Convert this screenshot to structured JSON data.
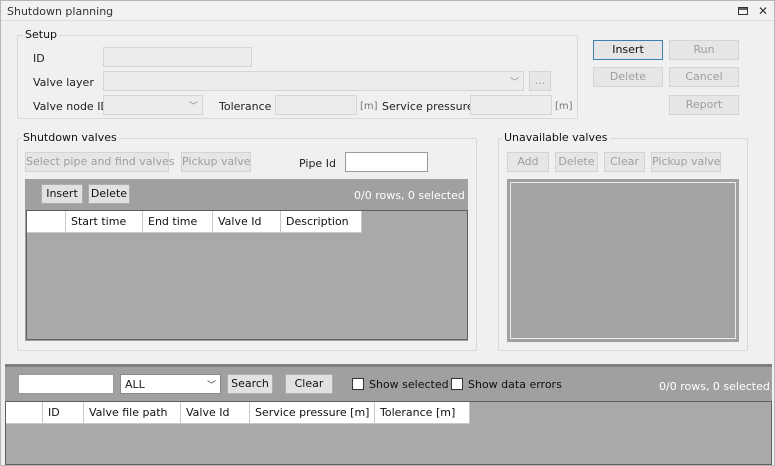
{
  "window": {
    "title": "Shutdown planning",
    "minimize_icon": "minimize-icon",
    "close_icon": "close-icon"
  },
  "setup": {
    "legend": "Setup",
    "id_label": "ID",
    "id_value": "",
    "valve_layer_label": "Valve layer",
    "valve_layer_value": "",
    "browse_label": "...",
    "valve_node_id_label": "Valve node ID",
    "valve_node_id_value": "",
    "tolerance_label": "Tolerance",
    "tolerance_value": "",
    "tolerance_unit": "[m]",
    "service_pressure_label": "Service pressure",
    "service_pressure_value": "",
    "service_pressure_unit": "[m]"
  },
  "actions": {
    "insert": "Insert",
    "run": "Run",
    "delete": "Delete",
    "cancel": "Cancel",
    "report": "Report"
  },
  "shutdown_valves": {
    "legend": "Shutdown valves",
    "select_pipe_label": "Select pipe and find valves",
    "pickup_valve_label": "Pickup valve",
    "pipe_id_label": "Pipe Id",
    "pipe_id_value": "",
    "grid": {
      "insert_label": "Insert",
      "delete_label": "Delete",
      "count": "0/0 rows, 0 selected",
      "columns": [
        "",
        "Start time",
        "End time",
        "Valve Id",
        "Description"
      ]
    }
  },
  "unavailable_valves": {
    "legend": "Unavailable valves",
    "add": "Add",
    "delete": "Delete",
    "clear": "Clear",
    "pickup_valve": "Pickup valve"
  },
  "filter_bar": {
    "search_text": "",
    "scope_value": "ALL",
    "search_label": "Search",
    "clear_label": "Clear",
    "show_selected_label": "Show selected",
    "show_selected_checked": false,
    "show_data_errors_label": "Show data errors",
    "show_data_errors_checked": false,
    "count": "0/0 rows, 0 selected"
  },
  "results_grid": {
    "columns": [
      "",
      "ID",
      "Valve file path",
      "Valve Id",
      "Service pressure [m]",
      "Tolerance [m]"
    ]
  },
  "colors": {
    "panel_gray": "#a0a0a0",
    "window_bg": "#f0f0f0",
    "focus_border": "#3c7fb1"
  }
}
